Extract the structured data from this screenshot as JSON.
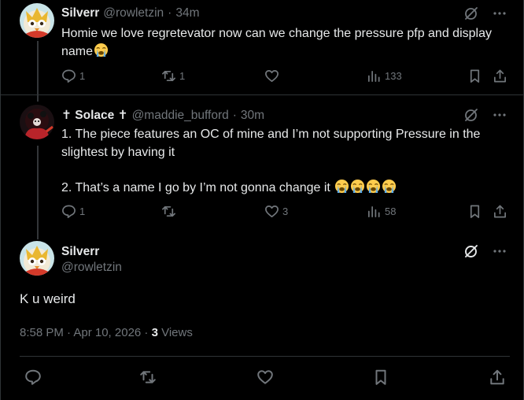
{
  "reply1": {
    "name": "Silverr",
    "handle": "@rowletzin",
    "separator": "·",
    "time": "34m",
    "text": "Homie we love regretevator now can we change the pressure pfp and display name",
    "emoji": "loudly-crying-face",
    "stats": {
      "replies": "1",
      "reposts": "1",
      "likes": "",
      "views": "133"
    }
  },
  "reply2": {
    "name": "✝ Solace ✝",
    "handle": "@maddie_bufford",
    "separator": "·",
    "time": "30m",
    "line1": "1. The piece features an OC of mine and I’m not supporting Pressure in the slightest by having it",
    "line2": "2. That’s a name I go by I’m not gonna change it",
    "stats": {
      "replies": "1",
      "reposts": "",
      "likes": "3",
      "views": "58"
    }
  },
  "main_post": {
    "name": "Silverr",
    "handle": "@rowletzin",
    "text": "K u weird",
    "timestamp": "8:58 PM · Apr 10, 2026 · ",
    "views_count": "3",
    "views_label": " Views"
  },
  "colors": {
    "background": "#000000",
    "text": "#e7e9ea",
    "muted": "#71767b",
    "border": "#2f3336"
  }
}
